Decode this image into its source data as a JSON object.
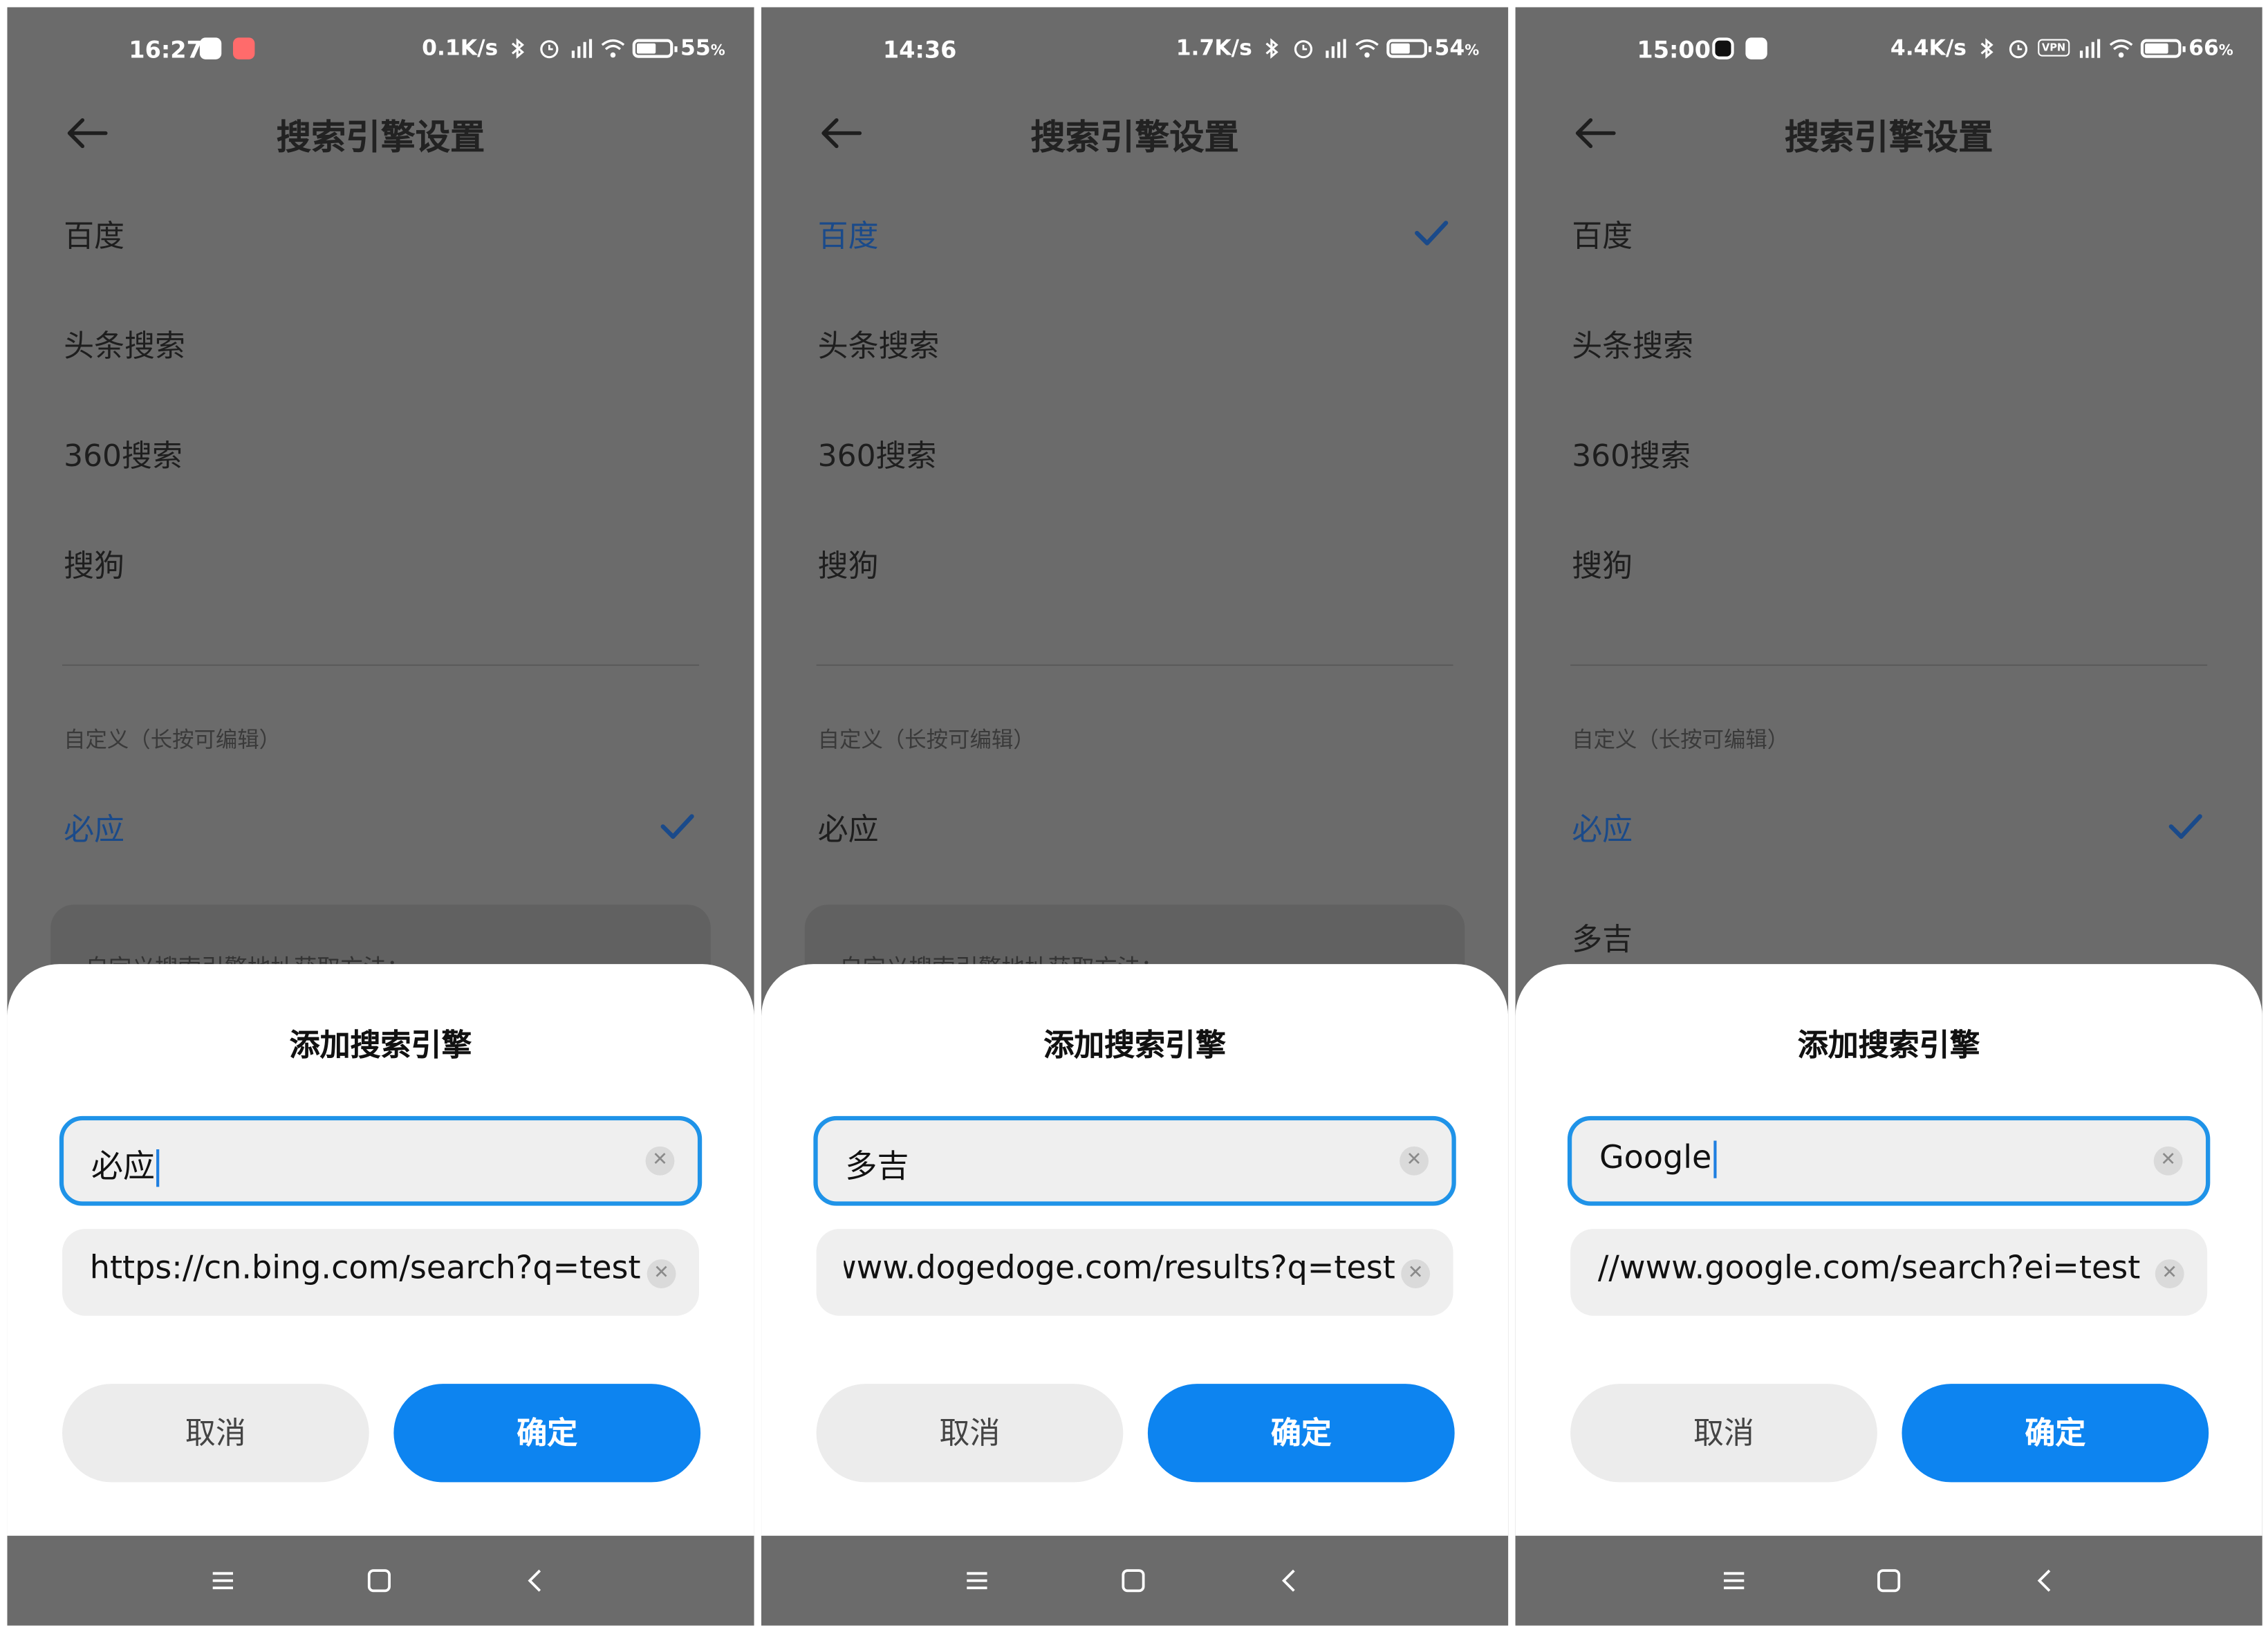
{
  "panels": [
    {
      "status": {
        "time": "16:27",
        "net_speed": "0.1K/s",
        "battery": "55",
        "battery_unit": "%",
        "battery_level": 0.55,
        "vpn": ""
      },
      "page_title": "搜索引擎设置",
      "engines": [
        "百度",
        "头条搜索",
        "360搜索",
        "搜狗"
      ],
      "section_label": "自定义（长按可编辑）",
      "custom_engines": [
        "必应"
      ],
      "hint": "自定义搜索引擎地址获取方法：",
      "dialog": {
        "title": "添加搜索引擎",
        "name_value": "必应",
        "url_value": "https://cn.bing.com/search?q=test",
        "cancel": "取消",
        "confirm": "确定"
      }
    },
    {
      "status": {
        "time": "14:36",
        "net_speed": "1.7K/s",
        "battery": "54",
        "battery_unit": "%",
        "battery_level": 0.54,
        "vpn": ""
      },
      "page_title": "搜索引擎设置",
      "engines": [
        "百度",
        "头条搜索",
        "360搜索",
        "搜狗"
      ],
      "section_label": "自定义（长按可编辑）",
      "custom_engines": [
        "必应"
      ],
      "hint": "自定义搜索引擎地址获取方法：",
      "dialog": {
        "title": "添加搜索引擎",
        "name_value": "多吉",
        "url_value": "www.dogedoge.com/results?q=test",
        "cancel": "取消",
        "confirm": "确定"
      }
    },
    {
      "status": {
        "time": "15:00",
        "net_speed": "4.4K/s",
        "battery": "66",
        "battery_unit": "%",
        "battery_level": 0.66,
        "vpn": "VPN"
      },
      "page_title": "搜索引擎设置",
      "engines": [
        "百度",
        "头条搜索",
        "360搜索",
        "搜狗"
      ],
      "section_label": "自定义（长按可编辑）",
      "custom_engines": [
        "必应",
        "多吉"
      ],
      "hint": "",
      "dialog": {
        "title": "添加搜索引擎",
        "name_value": "Google",
        "url_value": "//www.google.com/search?ei=test",
        "cancel": "取消",
        "confirm": "确定"
      }
    }
  ],
  "colors": {
    "accent": "#0d84f0",
    "selected_text": "#1a4a8a",
    "overlay": "#6b6b6b",
    "field_focus": "#1f93e8"
  },
  "icons": [
    "back-arrow-icon",
    "check-icon",
    "clear-icon",
    "menu-icon",
    "home-icon",
    "back-icon",
    "bluetooth-icon",
    "alarm-icon",
    "signal-icon",
    "wifi-icon",
    "battery-icon"
  ]
}
